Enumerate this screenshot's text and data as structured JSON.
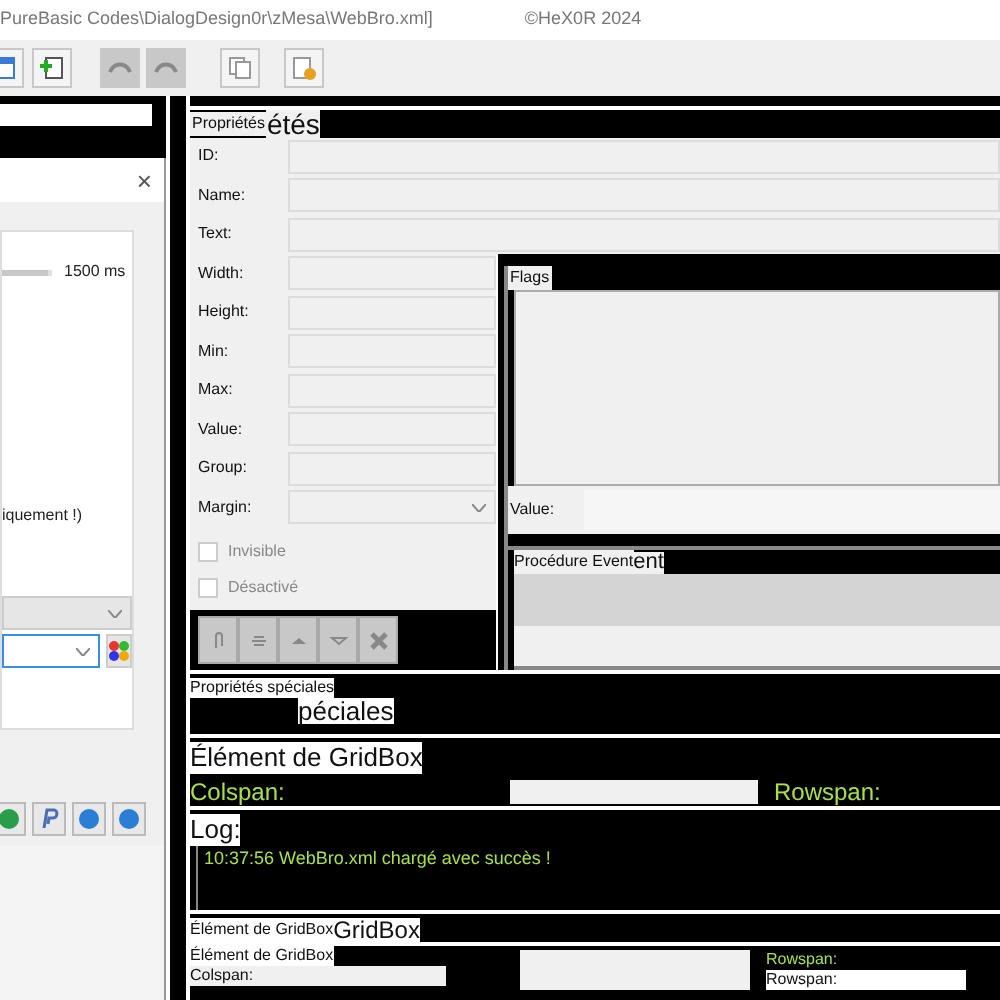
{
  "title": {
    "path": "PureBasic Codes\\DialogDesign0r\\zMesa\\WebBro.xml]",
    "copyright": "©HeX0R 2024"
  },
  "dialog": {
    "close": "×",
    "slider": {
      "level": 0.92,
      "reading": "1500 ms"
    },
    "note": "iquement !)",
    "combos": [
      {
        "focused": false
      },
      {
        "focused": true
      }
    ]
  },
  "properties": {
    "title": "Propriétés",
    "ghost": "étés",
    "fields": [
      {
        "label": "ID:",
        "kind": "text"
      },
      {
        "label": "Name:",
        "kind": "text"
      },
      {
        "label": "Text:",
        "kind": "text"
      },
      {
        "label": "Width:",
        "kind": "text"
      },
      {
        "label": "Height:",
        "kind": "text"
      },
      {
        "label": "Min:",
        "kind": "text"
      },
      {
        "label": "Max:",
        "kind": "text"
      },
      {
        "label": "Value:",
        "kind": "text"
      },
      {
        "label": "Group:",
        "kind": "text"
      },
      {
        "label": "Margin:",
        "kind": "combo"
      }
    ],
    "checkboxes": [
      {
        "label": "Invisible",
        "checked": false
      },
      {
        "label": "Désactivé",
        "checked": false
      }
    ]
  },
  "flags": {
    "title": "Flags"
  },
  "value_label": "Value:",
  "event": {
    "title": "Procédure Event",
    "ghost": "ent"
  },
  "special": {
    "title": "Propriétés spéciales",
    "ghost": "péciales"
  },
  "gridbox": {
    "title": "Élément de GridBox",
    "colspan": "Colspan:",
    "rowspan": "Rowspan:"
  },
  "log": {
    "title": "Log:",
    "lines": [
      "10:37:56 WebBro.xml chargé avec succès !"
    ]
  },
  "gridbox2": {
    "title": "Élément de GridBox",
    "ghost": "GridBox"
  },
  "gridbox3": {
    "title": "Élément de GridBox",
    "colspan": "Colspan:",
    "rowspan_top": "Rowspan:",
    "rowspan": "Rowspan:"
  }
}
